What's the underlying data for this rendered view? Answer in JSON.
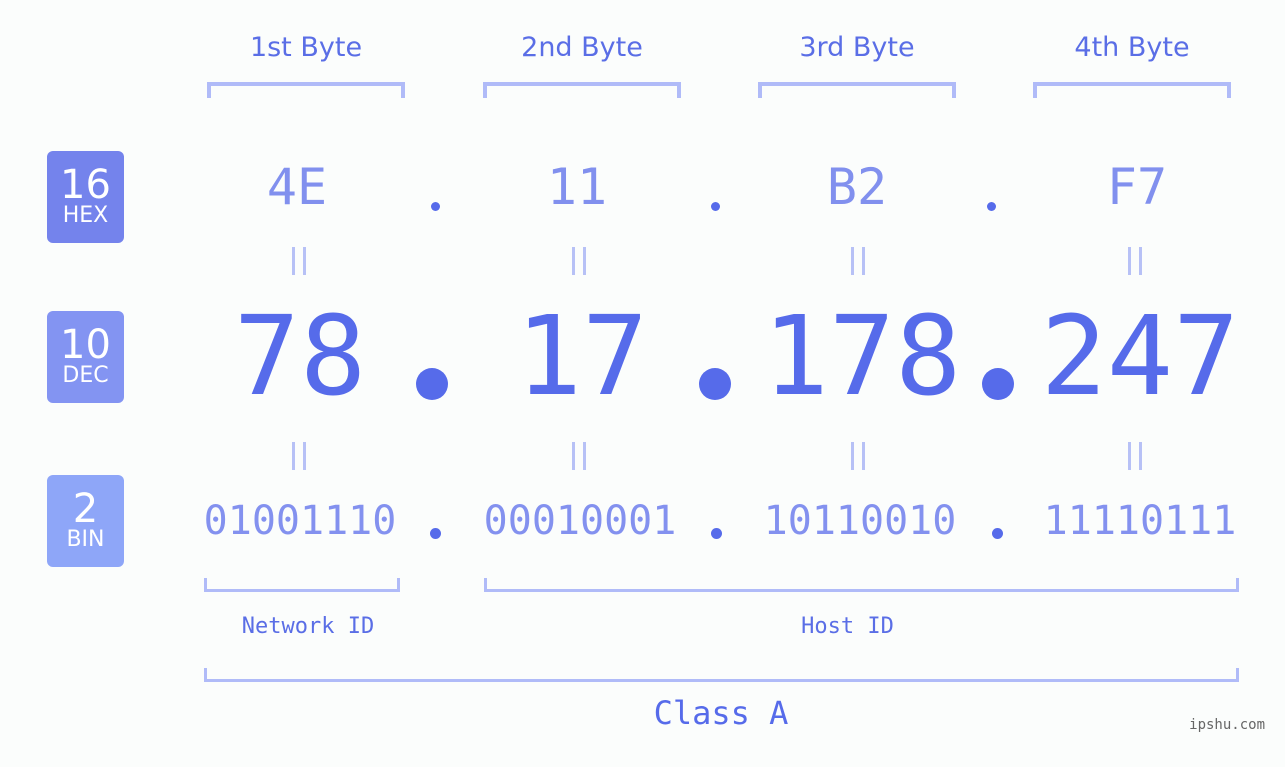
{
  "bytes": {
    "labels": [
      "1st Byte",
      "2nd Byte",
      "3rd Byte",
      "4th Byte"
    ],
    "hex": [
      "4E",
      "11",
      "B2",
      "F7"
    ],
    "dec": [
      "78",
      "17",
      "178",
      "247"
    ],
    "bin": [
      "01001110",
      "00010001",
      "10110010",
      "11110111"
    ]
  },
  "bases": {
    "hex": {
      "num": "16",
      "label": "HEX",
      "color": "#7483ec"
    },
    "dec": {
      "num": "10",
      "label": "DEC",
      "color": "#8394f2"
    },
    "bin": {
      "num": "2",
      "label": "BIN",
      "color": "#8ea6f8"
    }
  },
  "parts": {
    "network": "Network ID",
    "host": "Host ID"
  },
  "ip_class": "Class A",
  "watermark": "ipshu.com"
}
